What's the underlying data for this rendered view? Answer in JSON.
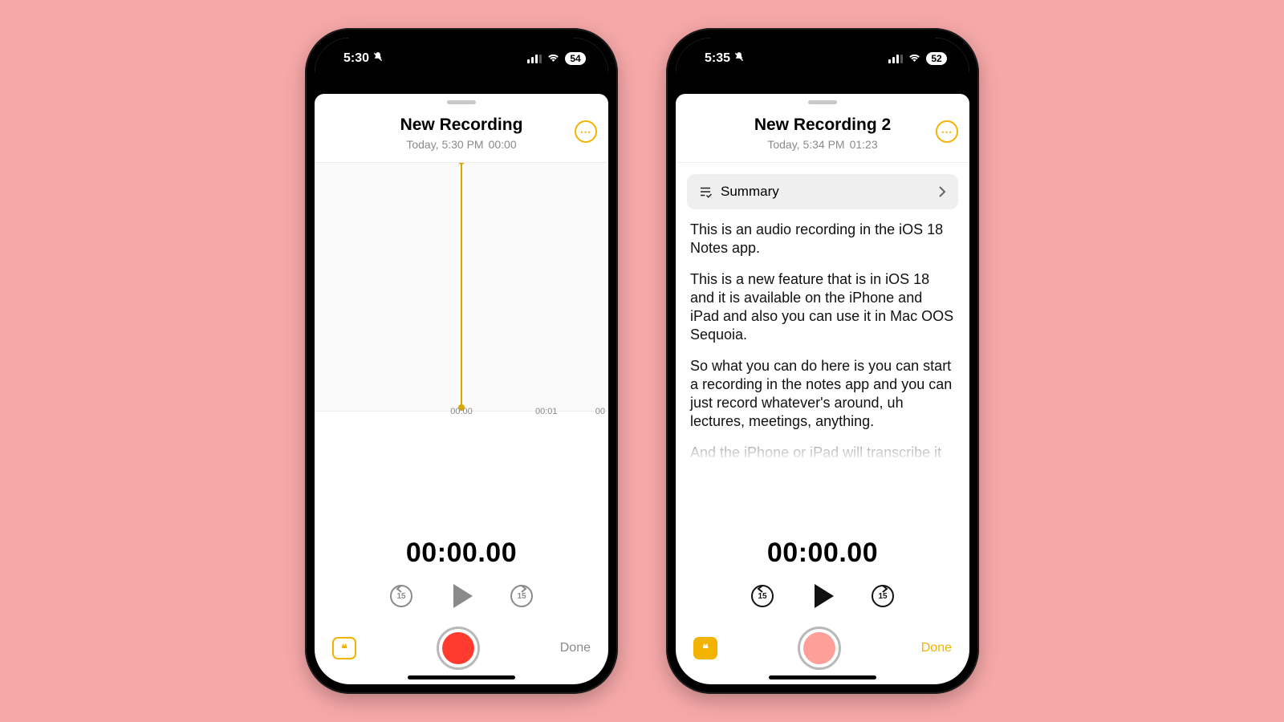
{
  "left": {
    "status": {
      "time": "5:30",
      "battery": "54"
    },
    "title": "New Recording",
    "subtitle": "Today, 5:30 PM",
    "subtitle_duration": "00:00",
    "ruler": {
      "t0": "00:00",
      "t1": "00:01",
      "t2": "00"
    },
    "big_time": "00:00.00",
    "skip_label": "15",
    "done": "Done"
  },
  "right": {
    "status": {
      "time": "5:35",
      "battery": "52"
    },
    "title": "New Recording 2",
    "subtitle": "Today, 5:34 PM",
    "subtitle_duration": "01:23",
    "summary_label": "Summary",
    "transcript": {
      "p1": "This is an audio recording in the iOS 18 Notes app.",
      "p2": "This is a new feature that is in iOS 18 and it is available on the iPhone and iPad and also you can use it in Mac OOS Sequoia.",
      "p3": "So what you can do here is you can start a recording in the notes app and you can just record whatever's around, uh lectures, meetings, anything.",
      "p4": "And the iPhone or iPad will transcribe it for you um right there so you can search"
    },
    "big_time": "00:00.00",
    "skip_label": "15",
    "done": "Done"
  }
}
